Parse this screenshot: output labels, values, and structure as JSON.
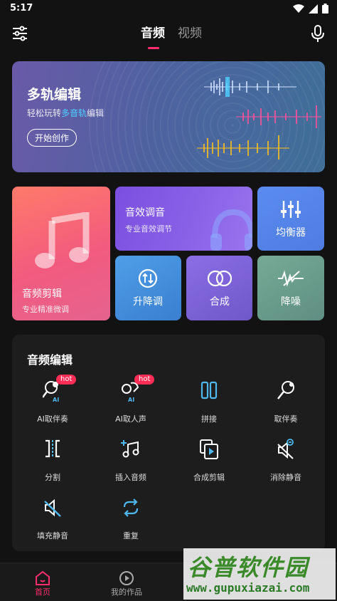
{
  "status": {
    "time": "5:17"
  },
  "header": {
    "tabs": [
      {
        "label": "音频",
        "active": true
      },
      {
        "label": "视频",
        "active": false
      }
    ]
  },
  "banner": {
    "title": "多轨编辑",
    "sub_prefix": "轻松玩转",
    "sub_highlight": "多音轨",
    "sub_suffix": "编辑",
    "cta": "开始创作"
  },
  "tiles": {
    "cut": {
      "label": "音频剪辑",
      "sub": "专业精准微调"
    },
    "effect": {
      "label": "音效调音",
      "sub": "专业音效调节"
    },
    "eq": {
      "label": "均衡器"
    },
    "pitch": {
      "label": "升降调"
    },
    "mix": {
      "label": "合成"
    },
    "noise": {
      "label": "降噪"
    }
  },
  "audio_edit": {
    "title": "音频编辑",
    "tools": [
      {
        "label": "AI取伴奏",
        "badge": "hot",
        "icon": "ai-mic-icon"
      },
      {
        "label": "AI取人声",
        "badge": "hot",
        "icon": "ai-voice-icon"
      },
      {
        "label": "拼接",
        "icon": "splice-icon"
      },
      {
        "label": "取伴奏",
        "icon": "mic-icon"
      },
      {
        "label": "分割",
        "icon": "split-icon"
      },
      {
        "label": "插入音频",
        "icon": "insert-audio-icon"
      },
      {
        "label": "合成剪辑",
        "icon": "merge-clip-icon"
      },
      {
        "label": "消除静音",
        "icon": "remove-silence-icon"
      },
      {
        "label": "填充静音",
        "icon": "fill-silence-icon"
      },
      {
        "label": "重复",
        "icon": "repeat-icon"
      }
    ]
  },
  "bottom_nav": {
    "home": "首页",
    "works": "我的作品"
  },
  "watermark": {
    "title": "谷普软件园",
    "url": "www.gupuxiazai.com"
  },
  "colors": {
    "accent": "#ff2d6f",
    "highlight": "#4fd1ff",
    "tool_icon": "#4fb8f0"
  }
}
